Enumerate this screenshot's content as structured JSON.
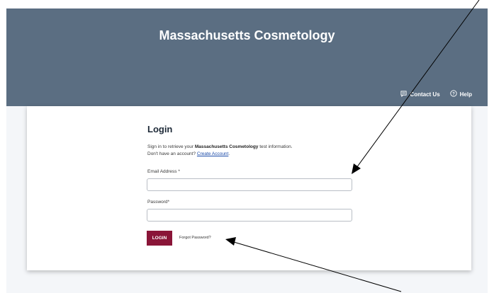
{
  "header": {
    "title": "Massachusetts Cosmetology",
    "contact_label": "Contact Us",
    "help_label": "Help"
  },
  "login": {
    "title": "Login",
    "intro_prefix": "Sign in to retrieve your ",
    "intro_brand": "Massachusetts Cosmetology",
    "intro_suffix": " test information.",
    "account_prompt": "Don't have an account? ",
    "create_account_link": "Create Account",
    "account_end": ".",
    "email_label": "Email Address *",
    "email_value": "",
    "password_label": "Password*",
    "password_value": "",
    "login_button": "LOGIN",
    "forgot_password_link": "Forgot Password?"
  },
  "colors": {
    "header_bg": "#5b6e82",
    "login_button": "#8a1538",
    "link": "#1a4aa8"
  },
  "icons": {
    "contact": "chat-icon",
    "help": "question-circle-icon"
  }
}
